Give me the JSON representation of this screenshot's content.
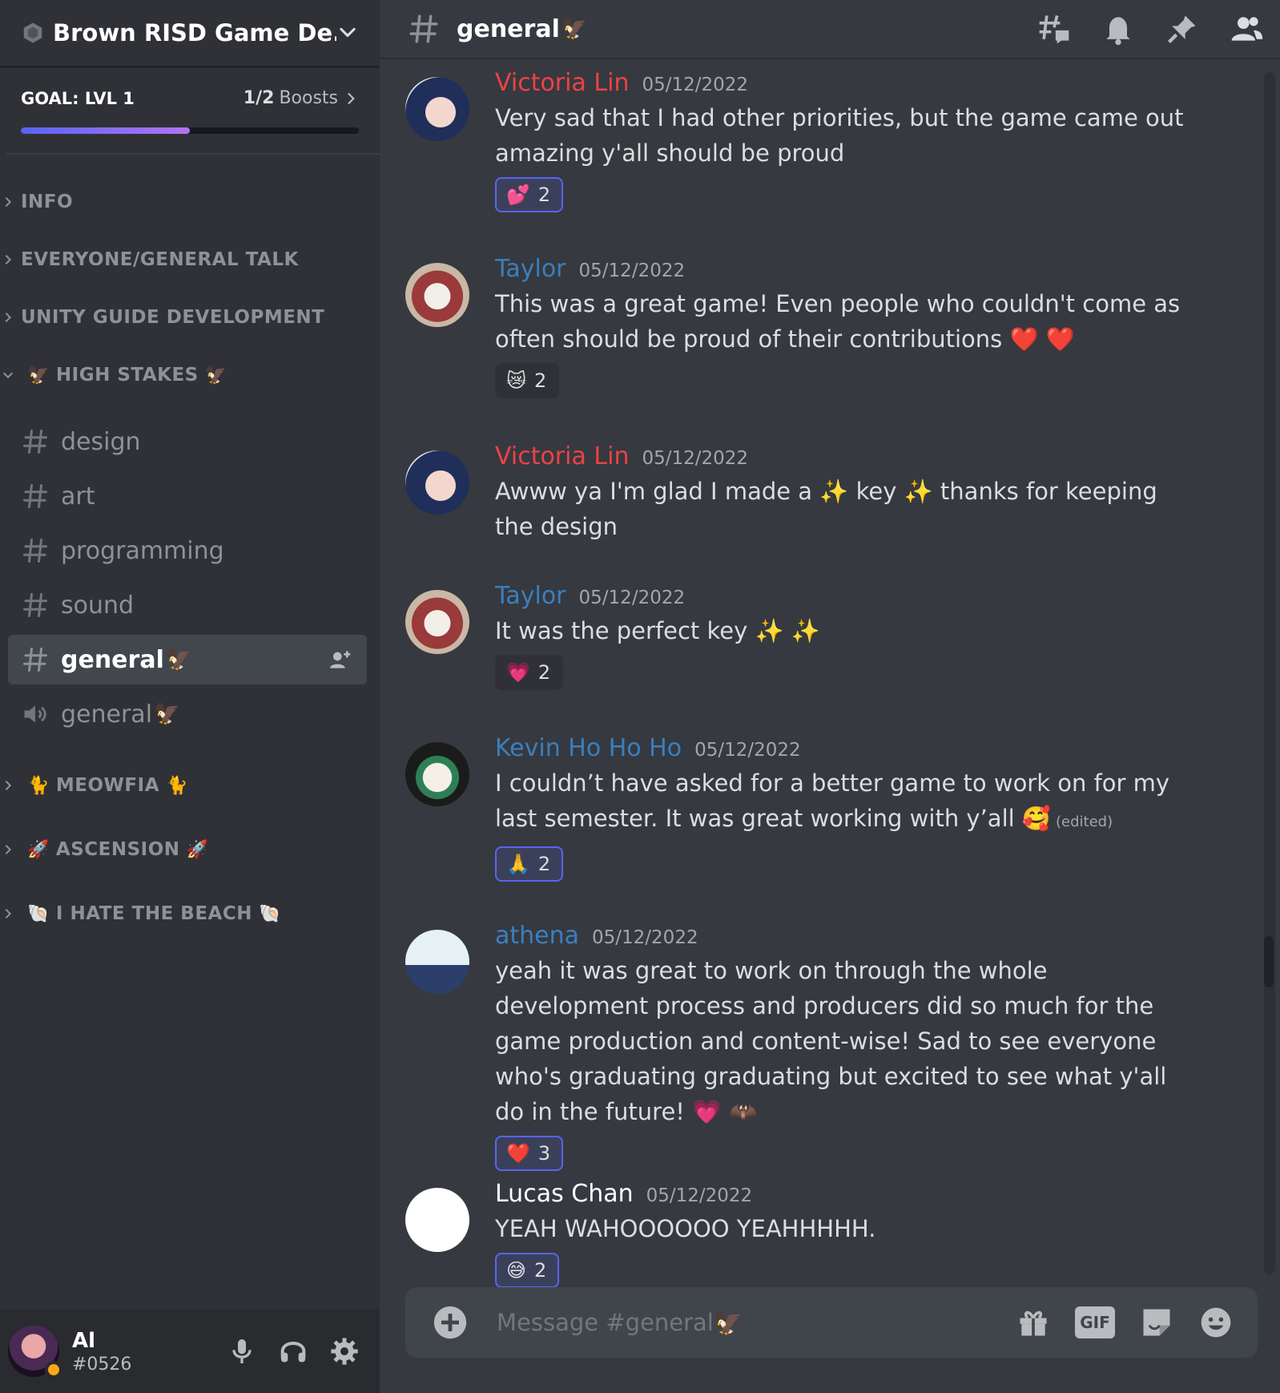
{
  "server": {
    "name": "Brown RISD Game De..."
  },
  "boost": {
    "goal": "GOAL: LVL 1",
    "count": "1/2",
    "label": "Boosts",
    "progress": 0.5
  },
  "categories": {
    "info": "INFO",
    "everyone": "EVERYONE/GENERAL TALK",
    "unity": "UNITY GUIDE DEVELOPMENT",
    "high_stakes": {
      "label": "HIGH STAKES",
      "emoji": "🦅"
    },
    "meowfia": {
      "label": "MEOWFIA",
      "emoji": "🐈"
    },
    "ascension": {
      "label": "ASCENSION",
      "emoji": "🚀"
    },
    "beach": {
      "label": "I HATE THE BEACH",
      "emoji": "🐚"
    }
  },
  "channels": [
    {
      "label": "design",
      "type": "text"
    },
    {
      "label": "art",
      "type": "text"
    },
    {
      "label": "programming",
      "type": "text"
    },
    {
      "label": "sound",
      "type": "text"
    },
    {
      "label": "general",
      "type": "text",
      "emoji": "🦅",
      "active": true
    },
    {
      "label": "general",
      "type": "voice",
      "emoji": "🦅"
    }
  ],
  "user": {
    "name": "Al",
    "tag": "#0526",
    "status_color": "#faa61a"
  },
  "header": {
    "channel": "general",
    "emoji": "🦅"
  },
  "messages": [
    {
      "author": "Victoria Lin",
      "author_color": "#ed4245",
      "timestamp": "05/12/2022",
      "text": "Very sad that I had other priorities, but the game came out amazing y'all should be proud",
      "reaction": {
        "emoji": "💕",
        "count": "2",
        "me": true
      }
    },
    {
      "author": "Taylor",
      "author_color": "#3a7fbf",
      "timestamp": "05/12/2022",
      "text": "This was a great game! Even people who couldn't come as often should be proud of their contributions ❤️ ❤️",
      "reaction": {
        "emoji": "😿",
        "count": "2",
        "me": false
      }
    },
    {
      "author": "Victoria Lin",
      "author_color": "#ed4245",
      "timestamp": "05/12/2022",
      "text": "Awww ya I'm glad I made a ✨ key ✨ thanks for keeping the design"
    },
    {
      "author": "Taylor",
      "author_color": "#3a7fbf",
      "timestamp": "05/12/2022",
      "text": "It was the perfect key ✨ ✨",
      "reaction": {
        "emoji": "💗",
        "count": "2",
        "me": false
      }
    },
    {
      "author": "Kevin Ho Ho Ho",
      "author_color": "#3a7fbf",
      "timestamp": "05/12/2022",
      "text": "I couldn’t have asked for a better game to work on for my last semester. It was great working with y’all 🥰",
      "edited": "(edited)",
      "reaction": {
        "emoji": "🙏",
        "count": "2",
        "me": true
      }
    },
    {
      "author": "athena",
      "author_color": "#3a7fbf",
      "timestamp": "05/12/2022",
      "text": "yeah it was great to work on through the whole development process and producers did so much for the game production and content-wise! Sad to see everyone who's graduating graduating but excited to see what y'all do in the future! 💗 🦇",
      "reaction": {
        "emoji": "❤️",
        "count": "3",
        "me": true
      }
    },
    {
      "author": "Lucas Chan",
      "author_color": "#ffffff",
      "timestamp": "05/12/2022",
      "text": "YEAH WAHOOOOOO YEAHHHHH.",
      "reaction": {
        "emoji": "😅",
        "count": "2",
        "me": true
      }
    }
  ],
  "composer": {
    "placeholder": "Message #general🦅",
    "gif_label": "GIF"
  }
}
